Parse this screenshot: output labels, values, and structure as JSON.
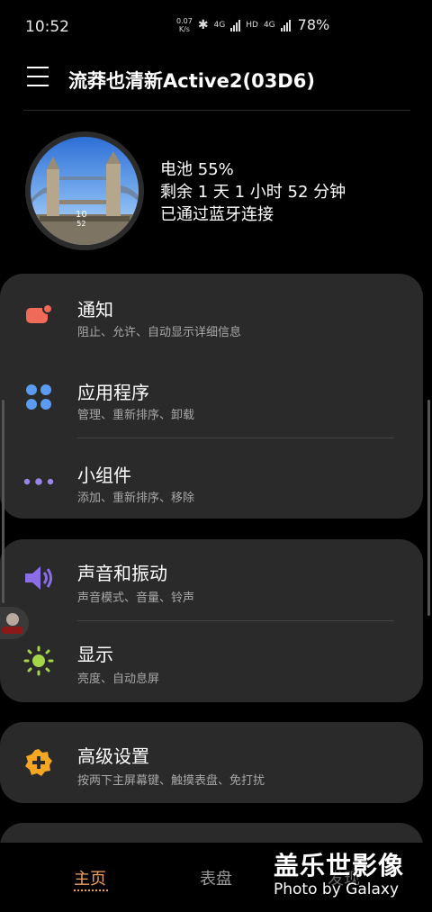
{
  "status_bar": {
    "time": "10:52",
    "net_speed_value": "0.07",
    "net_speed_unit": "K/s",
    "net_4g_1": "4G",
    "hd": "HD",
    "net_4g_2": "4G",
    "battery": "78%"
  },
  "header": {
    "title": "流莽也清新Active2(03D6)"
  },
  "watch": {
    "face_time": "10",
    "face_time_minutes": "52",
    "battery": "电池 55%",
    "remaining": "剩余 1 天 1 小时 52 分钟",
    "connection": "已通过蓝牙连接"
  },
  "menu": {
    "notifications": {
      "title": "通知",
      "subtitle": "阻止、允许、自动显示详细信息"
    },
    "apps": {
      "title": "应用程序",
      "subtitle": "管理、重新排序、卸载"
    },
    "widgets": {
      "title": "小组件",
      "subtitle": "添加、重新排序、移除"
    },
    "sound": {
      "title": "声音和振动",
      "subtitle": "声音模式、音量、铃声"
    },
    "display": {
      "title": "显示",
      "subtitle": "亮度、自动息屏"
    },
    "advanced": {
      "title": "高级设置",
      "subtitle": "按两下主屏幕键、触摸表盘、免打扰"
    }
  },
  "bottom_nav": {
    "home": "主页",
    "faces": "表盘",
    "discover": "发现"
  },
  "watermark": {
    "cn": "盖乐世影像",
    "en": "Photo by Galaxy"
  },
  "colors": {
    "accent": "#f2a35e",
    "notification_icon": "#f06a5a",
    "apps_icon": "#5b9cf0",
    "widgets_icon": "#9a84e8",
    "sound_icon": "#8a6ee8",
    "display_icon": "#a5d64a",
    "advanced_icon": "#f5a623"
  }
}
